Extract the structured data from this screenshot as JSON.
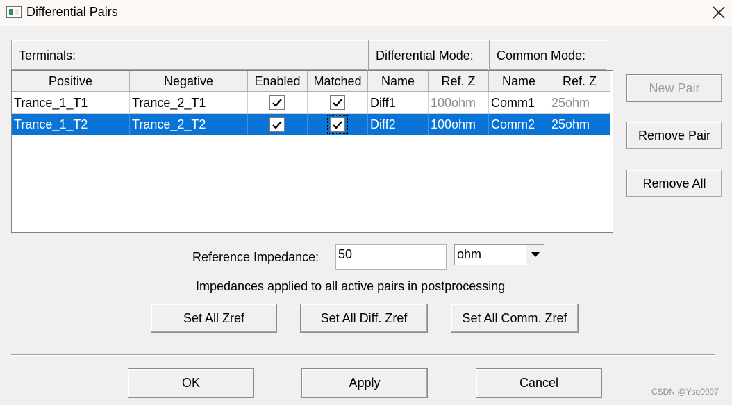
{
  "window": {
    "title": "Differential Pairs"
  },
  "groups": {
    "terminals": "Terminals:",
    "differential_mode": "Differential Mode:",
    "common_mode": "Common Mode:"
  },
  "table": {
    "columns": [
      "Positive",
      "Negative",
      "Enabled",
      "Matched",
      "Name",
      "Ref. Z",
      "Name",
      "Ref. Z"
    ],
    "rows": [
      {
        "positive": "Trance_1_T1",
        "negative": "Trance_2_T1",
        "enabled": true,
        "matched": true,
        "diff_name": "Diff1",
        "diff_refz": "100ohm",
        "comm_name": "Comm1",
        "comm_refz": "25ohm",
        "selected": false
      },
      {
        "positive": "Trance_1_T2",
        "negative": "Trance_2_T2",
        "enabled": true,
        "matched": true,
        "diff_name": "Diff2",
        "diff_refz": "100ohm",
        "comm_name": "Comm2",
        "comm_refz": "25ohm",
        "selected": true
      }
    ]
  },
  "side_buttons": {
    "new_pair": "New Pair",
    "remove_pair": "Remove Pair",
    "remove_all": "Remove All"
  },
  "reference": {
    "label": "Reference Impedance:",
    "value": "50",
    "unit": "ohm"
  },
  "info_text": "Impedances applied to all active pairs in postprocessing",
  "set_buttons": {
    "all": "Set All Zref",
    "diff": "Set All Diff. Zref",
    "comm": "Set All Comm. Zref"
  },
  "footer_buttons": {
    "ok": "OK",
    "apply": "Apply",
    "cancel": "Cancel"
  },
  "watermark": "CSDN @Ysq0907",
  "colors": {
    "selection": "#0a74d6",
    "muted_text": "#8a8a8a"
  }
}
